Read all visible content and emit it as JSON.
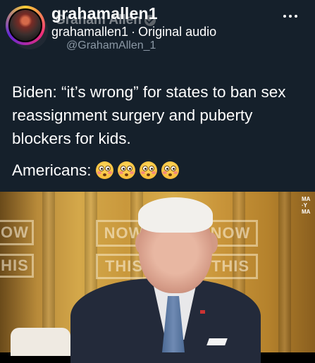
{
  "reel": {
    "username": "grahamallen1",
    "audio_user": "grahamallen1",
    "audio_sep": "·",
    "audio_label": "Original audio"
  },
  "tweet": {
    "display_name": "Graham Allen",
    "handle": "@GrahamAllen_1",
    "text": "Biden: “it’s wrong” for states to ban sex reassignment surgery and puberty blockers for kids.",
    "line2": "Americans:",
    "emoji": [
      "flushed-face",
      "flushed-face",
      "flushed-face",
      "flushed-face"
    ]
  },
  "video": {
    "signs": [
      "OW",
      "HIS",
      "NOW",
      "THIS",
      "NOW",
      "THIS"
    ],
    "corner_text": [
      "MA",
      "·Y",
      "MA"
    ]
  },
  "colors": {
    "tweet_bg": "#15202b",
    "secondary_text": "#8b98a5"
  }
}
